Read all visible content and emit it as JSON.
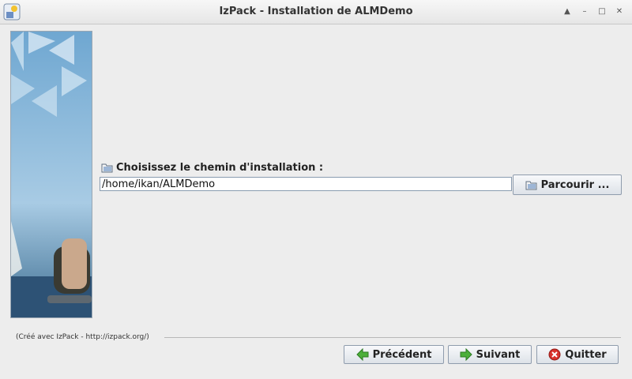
{
  "window": {
    "title": "IzPack - Installation de ALMDemo"
  },
  "panel": {
    "label": "Choisissez le chemin d'installation :",
    "path_value": "/home/ikan/ALMDemo",
    "browse_label": "Parcourir ..."
  },
  "footer": {
    "credit": "(Créé avec IzPack - http://izpack.org/)",
    "prev_label": "Précédent",
    "next_label": "Suivant",
    "quit_label": "Quitter"
  }
}
